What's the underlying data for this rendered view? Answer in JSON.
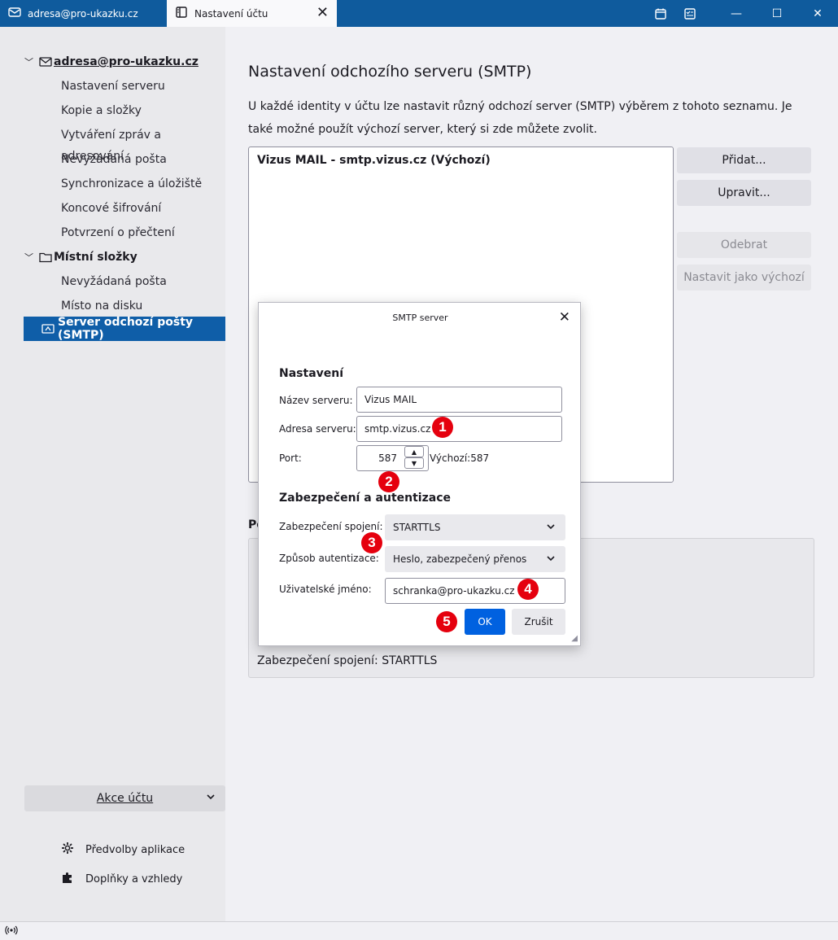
{
  "titlebar": {
    "tabs": [
      {
        "label": "adresa@pro-ukazku.cz"
      },
      {
        "label": "Nastavení účtu"
      }
    ]
  },
  "sidebar": {
    "account": "adresa@pro-ukazku.cz",
    "account_items": [
      "Nastavení serveru",
      "Kopie a složky",
      "Vytváření zpráv a adresování",
      "Nevyžádaná pošta",
      "Synchronizace a úložiště",
      "Koncové šifrování",
      "Potvrzení o přečtení"
    ],
    "local": "Místní složky",
    "local_items": [
      "Nevyžádaná pošta",
      "Místo na disku"
    ],
    "selected": "Server odchozí pošty (SMTP)",
    "akce": "Akce účtu",
    "prefs": "Předvolby aplikace",
    "addons": "Doplňky a vzhledy"
  },
  "main": {
    "title": "Nastavení odchozího serveru (SMTP)",
    "description": "U každé identity v účtu lze nastavit různý odchozí server (SMTP) výběrem z tohoto seznamu. Je také možné použít výchozí server, který si zde můžete zvolit.",
    "server_entry": "Vizus MAIL - smtp.vizus.cz (Výchozí)",
    "buttons": {
      "add": "Přidat...",
      "edit": "Upravit...",
      "remove": "Odebrat",
      "set_default": "Nastavit jako výchozí"
    },
    "details_head": "Po",
    "details_security": "Zabezpečení spojení:  STARTTLS"
  },
  "dialog": {
    "title": "SMTP server",
    "section_settings": "Nastavení",
    "label_name": "Název serveru:",
    "value_name": "Vizus MAIL",
    "label_address": "Adresa serveru:",
    "value_address": "smtp.vizus.cz",
    "label_port": "Port:",
    "value_port": "587",
    "port_default": "Výchozí:587",
    "section_security": "Zabezpečení a autentizace",
    "label_conn_security": "Zabezpečení spojení:",
    "value_conn_security": "STARTTLS",
    "label_auth": "Způsob autentizace:",
    "value_auth": "Heslo, zabezpečený přenos",
    "label_user": "Uživatelské jméno:",
    "value_user": "schranka@pro-ukazku.cz",
    "ok": "OK",
    "cancel": "Zrušit"
  },
  "badges": [
    "1",
    "2",
    "3",
    "4",
    "5"
  ],
  "colors": {
    "titlebar": "#0f5b9d",
    "selected": "#0f5ea8",
    "primary_button": "#0061e0",
    "badge": "#e5000e"
  },
  "icons": [
    "mail-icon",
    "tab-settings-icon",
    "calendar-icon",
    "tasks-icon",
    "minimize-icon",
    "maximize-icon",
    "close-icon",
    "folder-icon",
    "smtp-icon",
    "gear-icon",
    "puzzle-icon",
    "online-status-icon"
  ]
}
